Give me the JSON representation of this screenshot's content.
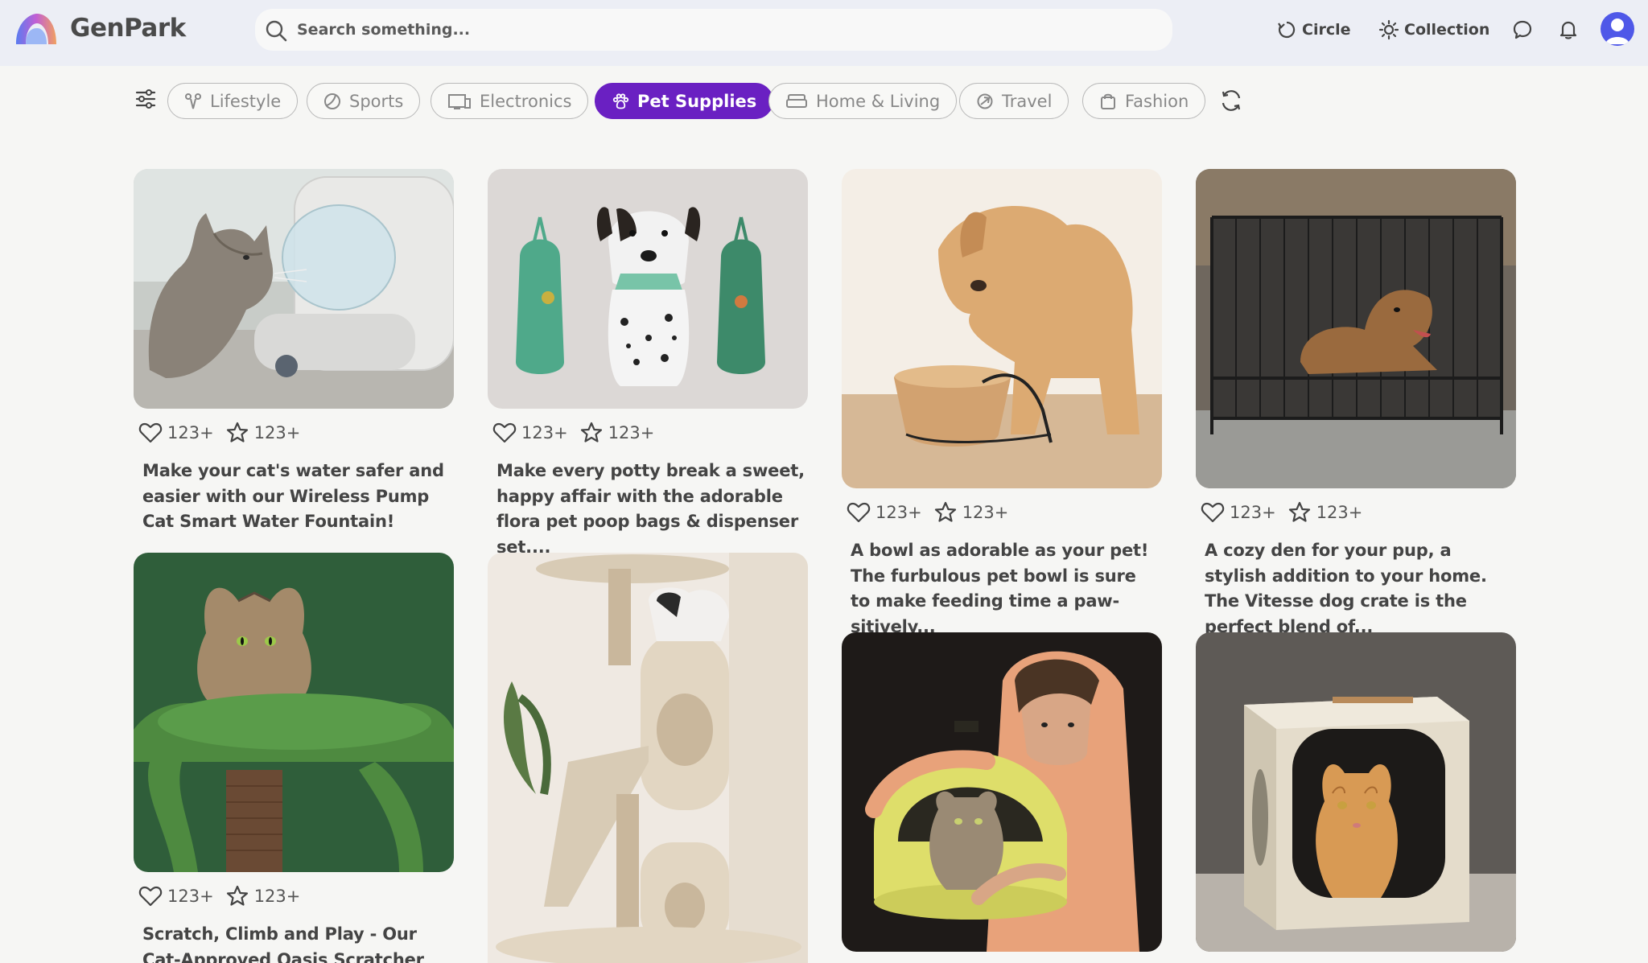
{
  "header": {
    "brand": "GenPark",
    "search_placeholder": "Search something...",
    "nav": {
      "circle": "Circle",
      "collection": "Collection"
    },
    "icons": [
      "logo-icon",
      "search-icon",
      "circle-icon",
      "collection-icon",
      "chat-icon",
      "bell-icon",
      "avatar-icon"
    ]
  },
  "filters": {
    "chips": [
      {
        "label": "Lifestyle",
        "icon": "lifestyle-icon",
        "active": false
      },
      {
        "label": "Sports",
        "icon": "sports-icon",
        "active": false
      },
      {
        "label": "Electronics",
        "icon": "electronics-icon",
        "active": false
      },
      {
        "label": "Pet Supplies",
        "icon": "paw-icon",
        "active": true
      },
      {
        "label": "Home & Living",
        "icon": "sofa-icon",
        "active": false
      },
      {
        "label": "Travel",
        "icon": "travel-icon",
        "active": false
      },
      {
        "label": "Fashion",
        "icon": "bag-icon",
        "active": false
      }
    ]
  },
  "cards": [
    {
      "likes": "123+",
      "stars": "123+",
      "desc": "Make your cat's water safer and easier with our Wireless Pump Cat Smart Water Fountain!",
      "image": "cat drinking from smart water fountain"
    },
    {
      "likes": "123+",
      "stars": "123+",
      "desc": "Make every potty break a sweet, happy affair with the adorable flora pet poop bags & dispenser set....",
      "image": "dalmatian with poop bag dispensers"
    },
    {
      "likes": "123+",
      "stars": "123+",
      "desc": "A bowl as adorable as your pet! The furbulous pet bowl is sure to make feeding time a paw-sitively...",
      "image": "puppy eating from wooden bowl"
    },
    {
      "likes": "123+",
      "stars": "123+",
      "desc": "A cozy den for your pup, a stylish addition to your home. The Vitesse dog crate is the perfect blend of...",
      "image": "dog lying in black metal crate"
    },
    {
      "likes": "123+",
      "stars": "123+",
      "desc": "Scratch, Climb and Play - Our Cat-Approved Oasis Scratcher Gives",
      "image": "cat on green cactus scratcher"
    },
    {
      "image": "cat on beige cat tree with slide"
    },
    {
      "image": "man with cat in yellow litter box"
    },
    {
      "image": "orange cat in beige cube bed"
    }
  ],
  "colors": {
    "accent": "#6a20c2",
    "header_bg": "#eceef5",
    "page_bg": "#f6f6f4"
  }
}
